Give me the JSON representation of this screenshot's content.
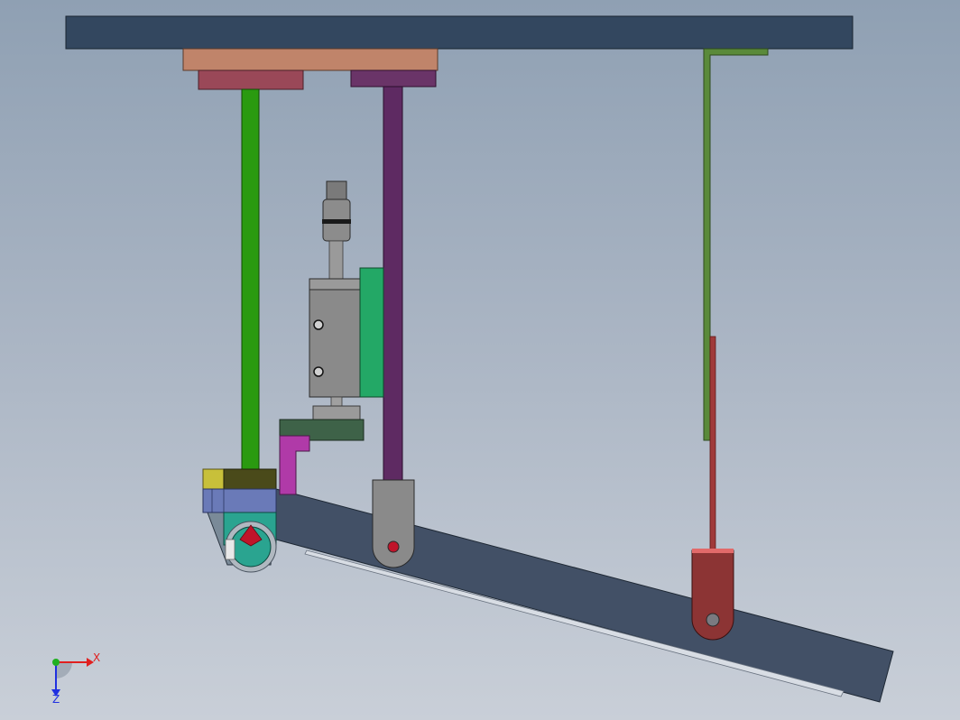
{
  "triad": {
    "x_label": "X",
    "z_label": "Z",
    "x_color": "#e02020",
    "y_color": "#20b020",
    "z_color": "#2030e0"
  },
  "colors": {
    "top_beam": "#33475f",
    "plate_bronze": "#c0846a",
    "block_maroon": "#9a4858",
    "bracket_purple": "#6a3468",
    "rod_green": "#2a9a10",
    "rod_purple": "#5e2a62",
    "cylinder_grey": "#8a8a8a",
    "cylinder_mount": "#23a866",
    "angle_green": "#5a8a3a",
    "link_red": "#a03a3a",
    "arm_dark": "#425066",
    "roller_teal": "#2aa490"
  }
}
